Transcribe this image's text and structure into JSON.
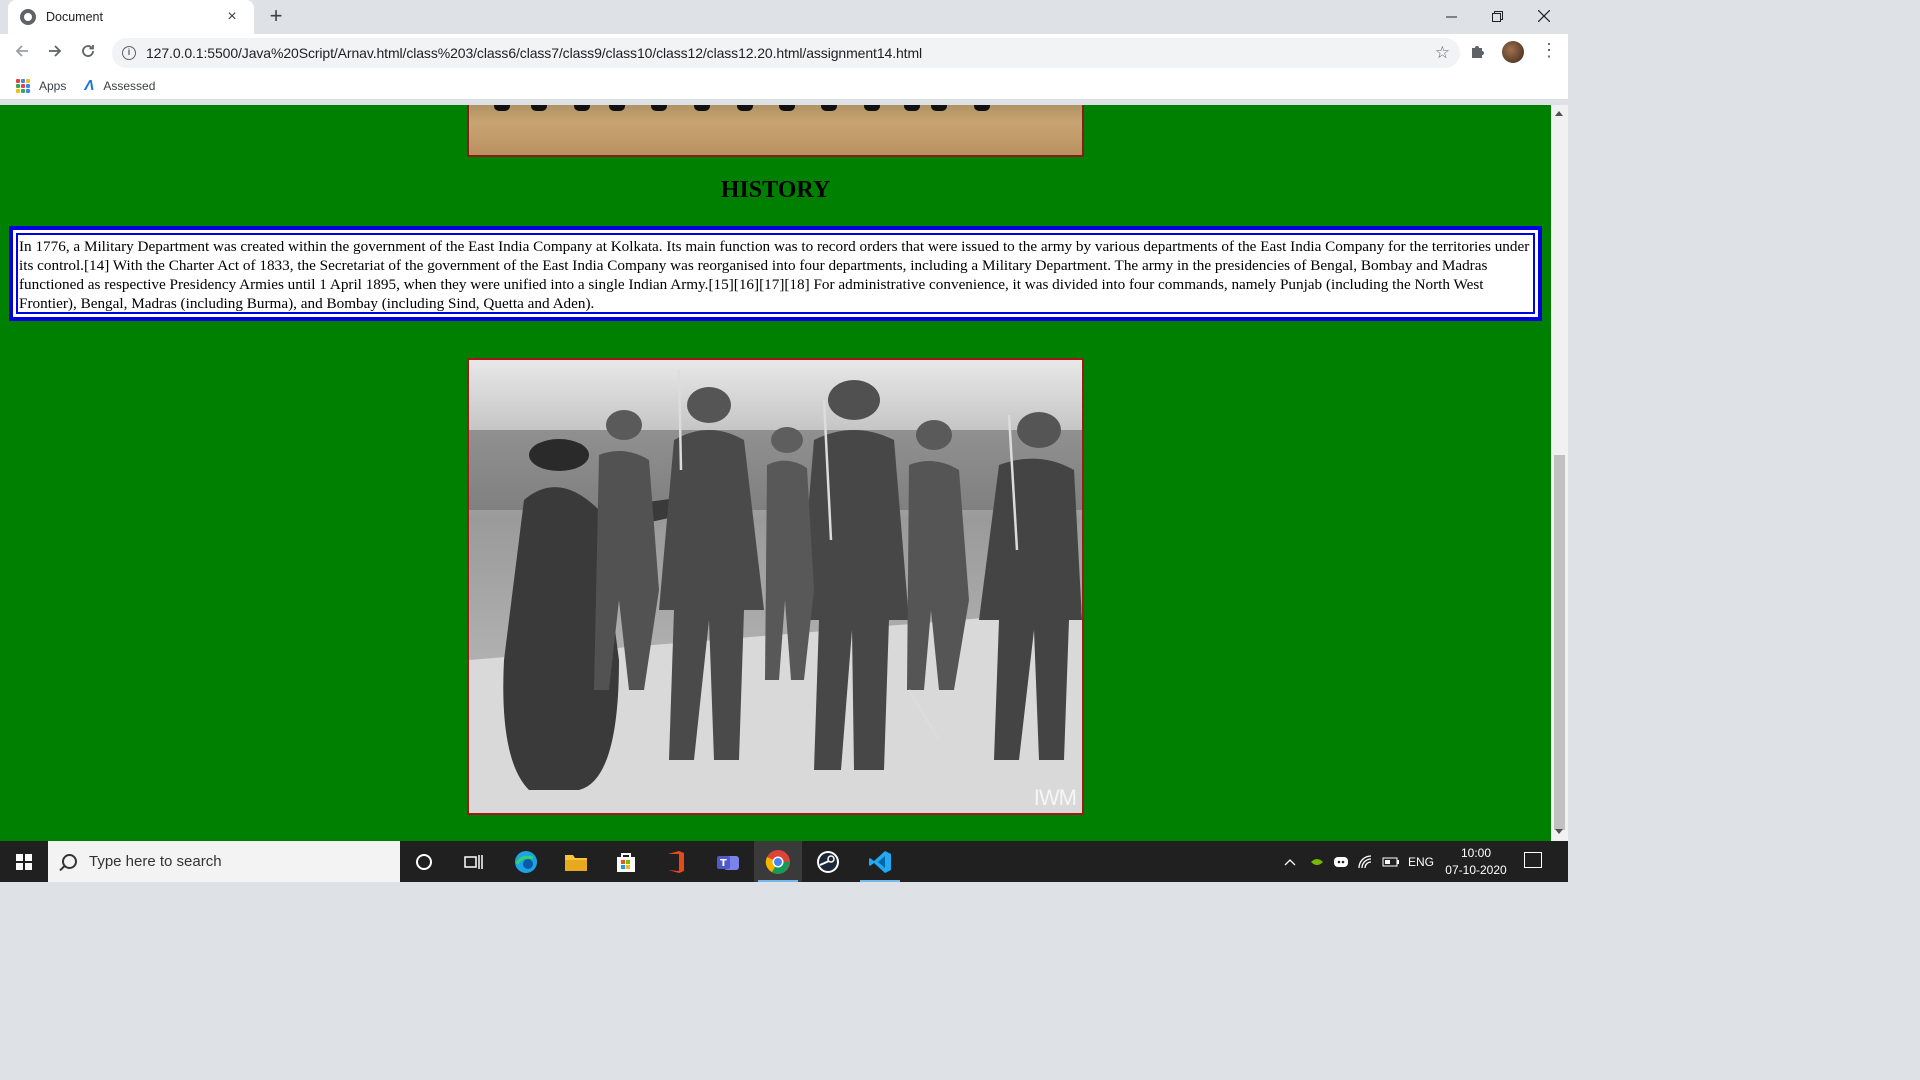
{
  "browser": {
    "tab_title": "Document",
    "tab_close": "×",
    "new_tab": "+",
    "url": "127.0.0.1:5500/Java%20Script/Arnav.html/class%203/class6/class7/class9/class10/class12/class12.20.html/assignment14.html",
    "bookmarks": [
      {
        "label": "Apps",
        "icon": "apps-grid-icon"
      },
      {
        "label": "Assessed",
        "icon": "assessed-icon"
      }
    ]
  },
  "page": {
    "history_title": "HISTORY",
    "history_text": "In 1776, a Military Department was created within the government of the East India Company at Kolkata. Its main function was to record orders that were issued to the army by various departments of the East India Company for the territories under its control.[14] With the Charter Act of 1833, the Secretariat of the government of the East India Company was reorganised into four departments, including a Military Department. The army in the presidencies of Bengal, Bombay and Madras functioned as respective Presidency Armies until 1 April 1895, when they were unified into a single Indian Army.[15][16][17][18] For administrative convenience, it was divided into four commands, namely Punjab (including the North West Frontier), Bengal, Madras (including Burma), and Bombay (including Sind, Quetta and Aden).",
    "photo_watermark": "IWM",
    "colors": {
      "page_bg": "#008000",
      "box_border": "#0000e0",
      "image_border": "#a01818"
    }
  },
  "taskbar": {
    "search_placeholder": "Type here to search",
    "language": "ENG",
    "time": "10:00",
    "date": "07-10-2020"
  }
}
